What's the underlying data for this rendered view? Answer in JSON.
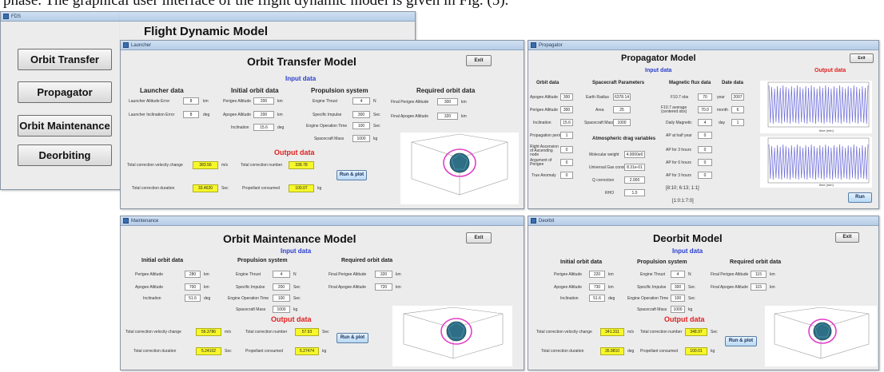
{
  "caption": "phase. The graphical user interface of the flight dynamic model is given in Fig. (5).",
  "main_window": {
    "window_title": "FDS",
    "title": "Flight Dynamic Model",
    "buttons": [
      "Orbit Transfer",
      "Propagator",
      "Orbit Maintenance",
      "Deorbiting"
    ]
  },
  "orbit_transfer": {
    "window_title": "Launcher",
    "title": "Orbit Transfer Model",
    "exit": "Exit",
    "input_data": "Input data",
    "launcher_data": "Launcher data",
    "launcher_altitude_error": "Launcher Altitude Error",
    "launcher_altitude_error_value": "8",
    "launcher_inclination_error": "Launcher Inclination Error",
    "launcher_inclination_error_value": "8",
    "initial_orbit_data": "Initial orbit data",
    "perigee_altitude": "Perigee Altitude",
    "perigee_altitude_value": "200",
    "apogee_altitude": "Apogee Altitude",
    "apogee_altitude_value": "200",
    "inclination": "Inclination",
    "inclination_value": "15.6",
    "propulsion_system": "Propulsion system",
    "engine_thrust": "Engine Thrust",
    "engine_thrust_value": "4",
    "specific_impulse": "Specific Impulse",
    "specific_impulse_value": "300",
    "engine_operation_time": "Engine Operation Time",
    "engine_operation_time_value": "100",
    "spacecraft_mass": "Spacecraft Mass",
    "spacecraft_mass_value": "1000",
    "required_orbit_data": "Required orbit data",
    "final_perigee_altitude": "Final Perigee Altitude",
    "final_perigee_altitude_value": "300",
    "final_apogee_altitude": "Final Apogee Altitude",
    "final_apogee_altitude_value": "320",
    "output_data": "Output data",
    "total_correction_velocity_change": "Total correction velocity change",
    "total_correction_velocity_change_value": "383.56",
    "total_correction_number": "Total correction number",
    "total_correction_number_value": "338.78",
    "total_correction_duration": "Total correction duration",
    "total_correction_duration_value": "33.4620",
    "propellant_consumed": "Propellant consumed",
    "propellant_consumed_value": "100.07",
    "run_button": "Run & plot",
    "unit_km": "km",
    "unit_deg": "deg",
    "unit_N": "N",
    "unit_sec": "Sec",
    "unit_kg": "kg",
    "unit_ms": "m/s"
  },
  "propagator": {
    "window_title": "Propagator",
    "title": "Propagator Model",
    "exit": "Exit",
    "input_data": "Input data",
    "output_data": "Output data",
    "orbit_data": "Orbit data",
    "spacecraft_parameters": "Spacecraft Parameters",
    "magnetic_flux_data": "Magnetic flux data",
    "date_data": "Date data",
    "atmospheric_drag_variables": "Atmospheric drag variables",
    "col1": [
      "Apogee Altitude",
      "Perigee Altitude",
      "Inclination",
      "Propagation period",
      "Right Ascension of Ascending node",
      "Argument of Perigee",
      "True Anomaly"
    ],
    "col1_values": [
      "300",
      "300",
      "15.6",
      "1",
      "0",
      "0",
      "0"
    ],
    "col2": [
      "Earth Radius",
      "Area",
      "Spacecraft Mass"
    ],
    "col2_values": [
      "6378.14",
      "25",
      "1000"
    ],
    "col2b": [
      "Molecular weight",
      "Universal Gas constant",
      "Q correction",
      "RHO"
    ],
    "col2b_values": [
      "4.0000e0",
      "8.31e-01",
      "2.000",
      "1.0"
    ],
    "col3": [
      "F10.7 obs",
      "F10.7 average (centered obs)",
      "Daily Magnetic",
      "AP at half year",
      "AP for 3 hours",
      "AP for 6 hours",
      "AP for 3 hours"
    ],
    "col3_values": [
      "70",
      "70.0",
      "4",
      "0",
      "0",
      "0",
      "0"
    ],
    "col4": [
      "year",
      "month",
      "day"
    ],
    "col4_values": [
      "2007",
      "6",
      "1"
    ],
    "arr1": "[8:10; 6:13; 1:1]",
    "arr2": "[1:0:1:7:0]",
    "run": "Run",
    "time_label": "time (min)"
  },
  "orbit_maintenance": {
    "window_title": "Maintenance",
    "title": "Orbit Maintenance Model",
    "exit": "Exit",
    "input_data": "Input data",
    "initial_orbit_data": "Initial orbit data",
    "perigee_altitude": "Perigee Altitude",
    "perigee_altitude_value": "280",
    "apogee_altitude": "Apogee Altitude",
    "apogee_altitude_value": "700",
    "inclination": "Inclination",
    "inclination_value": "51.6",
    "propulsion_system": "Propulsion system",
    "engine_thrust": "Engine Thrust",
    "engine_thrust_value": "4",
    "specific_impulse": "Specific Impulse",
    "specific_impulse_value": "200",
    "engine_operation_time": "Engine Operation Time",
    "engine_operation_time_value": "100",
    "spacecraft_mass": "Spacecraft Mass",
    "spacecraft_mass_value": "1000",
    "required_orbit_data": "Required orbit data",
    "final_perigee_altitude": "Final Perigee Altitude",
    "final_perigee_altitude_value": "320",
    "final_apogee_altitude": "Final Apogee Altitude",
    "final_apogee_altitude_value": "720",
    "output_data": "Output data",
    "total_correction_velocity_change": "Total correction velocity change",
    "total_correction_velocity_change_value": "56.3786",
    "total_correction_number": "Total correction number",
    "total_correction_number_value": "57.93",
    "total_correction_duration": "Total correction duration",
    "total_correction_duration_value": "5.24102",
    "propellant_consumed": "Propellant consumed",
    "propellant_consumed_value": "5.27474",
    "run_button": "Run & plot",
    "unit_km": "km",
    "unit_deg": "deg",
    "unit_N": "N",
    "unit_sec": "Sec",
    "unit_kg": "kg",
    "unit_ms": "m/s"
  },
  "deorbit": {
    "window_title": "Deorbit",
    "title": "Deorbit Model",
    "exit": "Exit",
    "input_data": "Input data",
    "initial_orbit_data": "Initial orbit data",
    "perigee_altitude": "Perigee Altitude",
    "perigee_altitude_value": "220",
    "apogee_altitude": "Apogee Altitude",
    "apogee_altitude_value": "730",
    "inclination": "Inclination",
    "inclination_value": "51.6",
    "propulsion_system": "Propulsion system",
    "engine_thrust": "Engine Thrust",
    "engine_thrust_value": "4",
    "specific_impulse": "Specific Impulse",
    "specific_impulse_value": "300",
    "engine_operation_time": "Engine Operation Time",
    "engine_operation_time_value": "100",
    "spacecraft_mass": "Spacecraft Mass",
    "spacecraft_mass_value": "1000",
    "required_orbit_data": "Required orbit data",
    "final_perigee_altitude": "Final Perigee Altitude",
    "final_perigee_altitude_value": "115",
    "final_apogee_altitude": "Final Apogee Altitude",
    "final_apogee_altitude_value": "115",
    "output_data": "Output data",
    "total_correction_velocity_change": "Total correction velocity change",
    "total_correction_velocity_change_value": "341.311",
    "total_correction_number": "Total correction number",
    "total_correction_number_value": "348.97",
    "total_correction_duration": "Total correction duration",
    "total_correction_duration_value": "35.9810",
    "propellant_consumed": "Propellant consumed",
    "propellant_consumed_value": "100.01",
    "run_button": "Run & plot",
    "unit_km": "km",
    "unit_deg": "deg",
    "unit_N": "N",
    "unit_sec": "Sec",
    "unit_kg": "kg",
    "unit_ms": "m/s"
  },
  "colors": {
    "input_header": "#2b3fcc",
    "output_header": "#e02020",
    "highlight": "#f7f72a",
    "orbit_ring": "#e040c8",
    "earth": "#2f6f86"
  }
}
